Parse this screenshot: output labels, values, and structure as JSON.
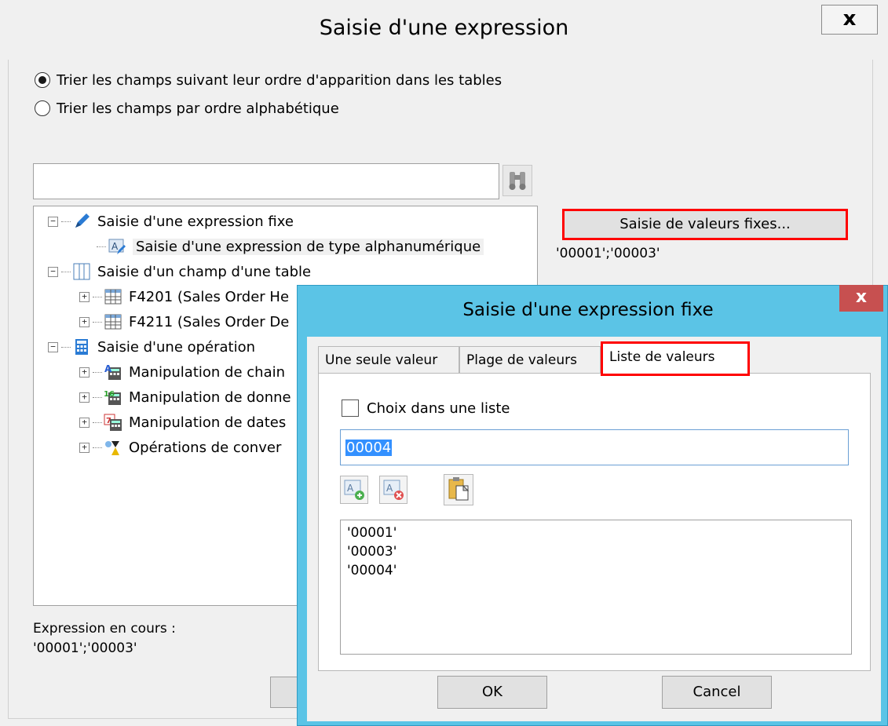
{
  "back_dialog": {
    "title": "Saisie d'une expression",
    "close_label": "x",
    "sort_options": [
      {
        "label": "Trier les champs suivant leur ordre d'apparition dans les tables",
        "selected": true
      },
      {
        "label": "Trier les champs par ordre alphabétique",
        "selected": false
      }
    ],
    "search": {
      "value": "",
      "placeholder": ""
    },
    "tree": {
      "fixed_expression": "Saisie d'une expression fixe",
      "alphanumeric_expression": "Saisie d'une expression de type alphanumérique",
      "table_field": "Saisie d'un champ d'une table",
      "table_f4201": "F4201 (Sales Order He",
      "table_f4211": "F4211 (Sales Order De",
      "operation": "Saisie d'une opération",
      "string_manipulation": "Manipulation de chain",
      "data_manipulation": "Manipulation de donne",
      "date_manipulation": "Manipulation de dates",
      "conversion_operations": "Opérations de conver"
    },
    "fixed_values_button": "Saisie de valeurs fixes...",
    "fixed_values_text": "'00001';'00003'",
    "current_expression_label": "Expression en cours :",
    "current_expression_value": "'00001';'00003'"
  },
  "front_dialog": {
    "title": "Saisie d'une expression fixe",
    "close_label": "x",
    "tabs": [
      "Une seule valeur",
      "Plage de valeurs",
      "Liste de valeurs"
    ],
    "active_tab": "Liste de valeurs",
    "choice_checkbox_label": "Choix dans une liste",
    "choice_checked": false,
    "value_input": "00004",
    "list_values": [
      "'00001'",
      "'00003'",
      "'00004'"
    ],
    "ok_label": "OK",
    "cancel_label": "Cancel"
  },
  "colors": {
    "highlight_border": "#ff0000",
    "front_title_bar": "#5bc4e6",
    "front_close": "#c75050",
    "selection": "#3390ff"
  },
  "icons": [
    "binoculars-icon",
    "pencil-icon",
    "alpha-edit-icon",
    "table-icon",
    "calculator-icon",
    "add-value-icon",
    "remove-value-icon",
    "paste-icon"
  ]
}
